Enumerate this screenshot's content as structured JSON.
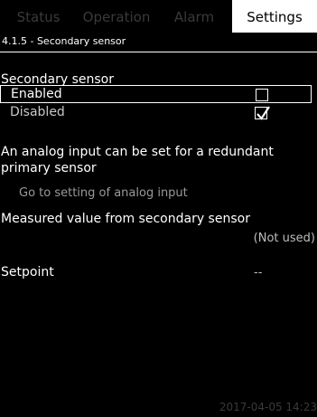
{
  "tabs": [
    {
      "label": "Status"
    },
    {
      "label": "Operation"
    },
    {
      "label": "Alarm"
    },
    {
      "label": "Settings"
    }
  ],
  "breadcrumb": "4.1.5 - Secondary sensor",
  "section_title": "Secondary sensor",
  "options": [
    {
      "label": "Enabled",
      "checked": false
    },
    {
      "label": "Disabled",
      "checked": true
    }
  ],
  "info_text": "An analog input can be set for a redundant primary sensor",
  "link_text": "Go to setting of analog input",
  "measured_value": {
    "label": "Measured value from secondary sensor",
    "value": "(Not used)"
  },
  "setpoint": {
    "label": "Setpoint",
    "value": "--"
  },
  "datetime": "2017-04-05 14:23",
  "colors": {
    "background": "#000000",
    "active_tab": "#ffffff",
    "inactive_tab_text": "#3a3a3a"
  }
}
